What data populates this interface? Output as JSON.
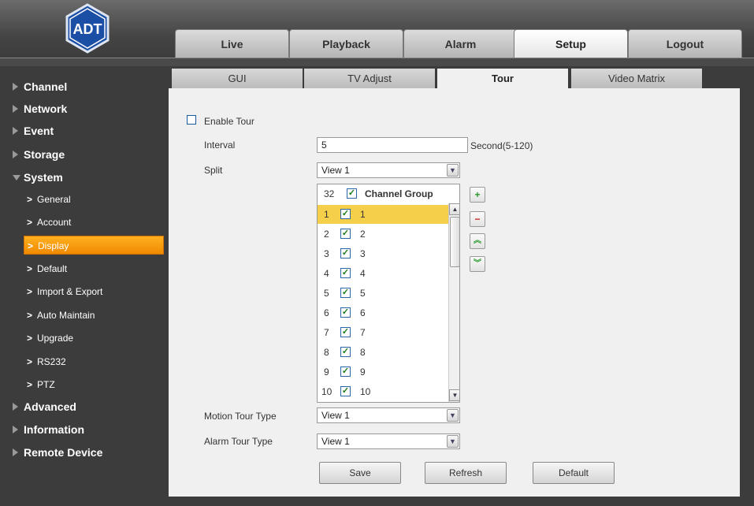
{
  "brand": {
    "logo_text": "ADT"
  },
  "main_tabs": [
    {
      "label": "Live"
    },
    {
      "label": "Playback"
    },
    {
      "label": "Alarm"
    },
    {
      "label": "Setup",
      "active": true
    },
    {
      "label": "Logout"
    }
  ],
  "sub_tabs": [
    {
      "label": "GUI"
    },
    {
      "label": "TV Adjust"
    },
    {
      "label": "Tour",
      "active": true
    },
    {
      "label": "Video Matrix"
    }
  ],
  "sidebar": {
    "sections": [
      {
        "label": "Channel"
      },
      {
        "label": "Network"
      },
      {
        "label": "Event"
      },
      {
        "label": "Storage"
      },
      {
        "label": "System",
        "expanded": true
      },
      {
        "label": "Advanced"
      },
      {
        "label": "Information"
      },
      {
        "label": "Remote Device"
      }
    ],
    "system_items": [
      {
        "label": "General"
      },
      {
        "label": "Account"
      },
      {
        "label": "Display",
        "active": true
      },
      {
        "label": "Default"
      },
      {
        "label": "Import & Export"
      },
      {
        "label": "Auto Maintain"
      },
      {
        "label": "Upgrade"
      },
      {
        "label": "RS232"
      },
      {
        "label": "PTZ"
      }
    ]
  },
  "form": {
    "enable_tour_label": "Enable Tour",
    "enable_tour_checked": false,
    "interval_label": "Interval",
    "interval_value": "5",
    "interval_unit": "Second(5-120)",
    "split_label": "Split",
    "split_value": "View 1",
    "list_header_num": "32",
    "list_header_label": "Channel Group",
    "channels": [
      {
        "num": "1",
        "name": "1",
        "checked": true,
        "selected": true
      },
      {
        "num": "2",
        "name": "2",
        "checked": true
      },
      {
        "num": "3",
        "name": "3",
        "checked": true
      },
      {
        "num": "4",
        "name": "4",
        "checked": true
      },
      {
        "num": "5",
        "name": "5",
        "checked": true
      },
      {
        "num": "6",
        "name": "6",
        "checked": true
      },
      {
        "num": "7",
        "name": "7",
        "checked": true
      },
      {
        "num": "8",
        "name": "8",
        "checked": true
      },
      {
        "num": "9",
        "name": "9",
        "checked": true
      },
      {
        "num": "10",
        "name": "10",
        "checked": true
      }
    ],
    "motion_tour_label": "Motion Tour Type",
    "motion_tour_value": "View 1",
    "alarm_tour_label": "Alarm Tour Type",
    "alarm_tour_value": "View 1"
  },
  "buttons": {
    "save": "Save",
    "refresh": "Refresh",
    "default": "Default"
  },
  "colors": {
    "accent": "#f5a000",
    "selected_row": "#f5cf4a",
    "sidebar_bg": "#3c3c3c"
  }
}
